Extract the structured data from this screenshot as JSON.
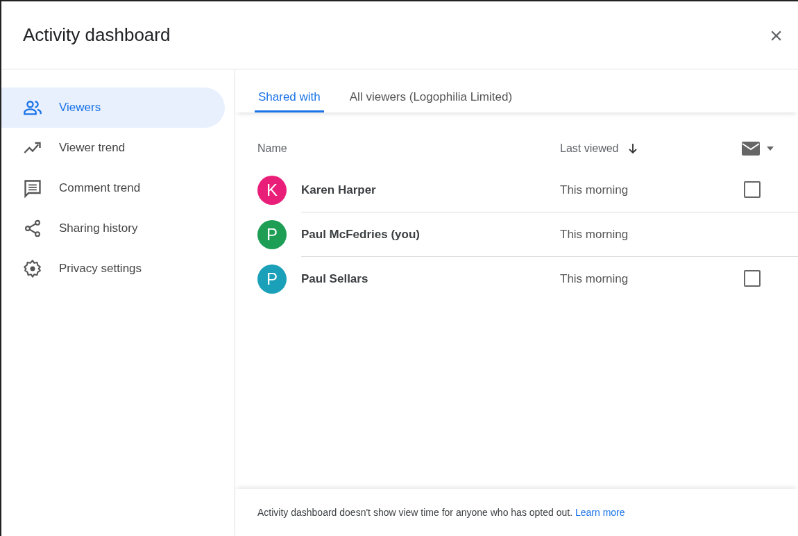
{
  "window": {
    "title": "Activity dashboard",
    "close": "×"
  },
  "sidebar": {
    "items": [
      {
        "label": "Viewers",
        "selected": true
      },
      {
        "label": "Viewer trend",
        "selected": false
      },
      {
        "label": "Comment trend",
        "selected": false
      },
      {
        "label": "Sharing history",
        "selected": false
      },
      {
        "label": "Privacy settings",
        "selected": false
      }
    ]
  },
  "tabs": [
    {
      "label": "Shared with",
      "selected": true
    },
    {
      "label": "All viewers (Logophilia Limited)",
      "selected": false
    }
  ],
  "table": {
    "columns": [
      "Name",
      "Last viewed"
    ],
    "rows": [
      {
        "initial": "K",
        "color": "#e91e78",
        "name": "Karen Harper",
        "last_viewed": "This morning",
        "checked": false
      },
      {
        "initial": "P",
        "color": "#1e9e55",
        "name": "Paul McFedries (you)",
        "last_viewed": "This morning"
      },
      {
        "initial": "P",
        "color": "#1aa0b8",
        "name": "Paul Sellars",
        "last_viewed": "This morning",
        "checked": false
      }
    ]
  },
  "footer": {
    "text": "Activity dashboard doesn't show view time for anyone who has opted out.",
    "link": "Learn more"
  }
}
